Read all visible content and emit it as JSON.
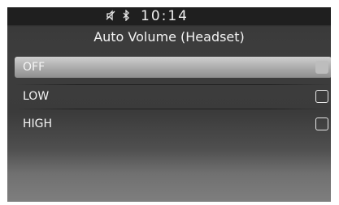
{
  "status_bar": {
    "mute_icon": "mute-icon",
    "bluetooth_icon": "bluetooth-icon",
    "time": "10:14"
  },
  "screen": {
    "title": "Auto Volume (Headset)"
  },
  "options": [
    {
      "label": "OFF",
      "selected": true
    },
    {
      "label": "LOW",
      "selected": false
    },
    {
      "label": "HIGH",
      "selected": false
    }
  ],
  "colors": {
    "selected_highlight": "#b0b0b0",
    "text": "#f5f5f5",
    "status_bar_bg": "#1f1f1f"
  }
}
